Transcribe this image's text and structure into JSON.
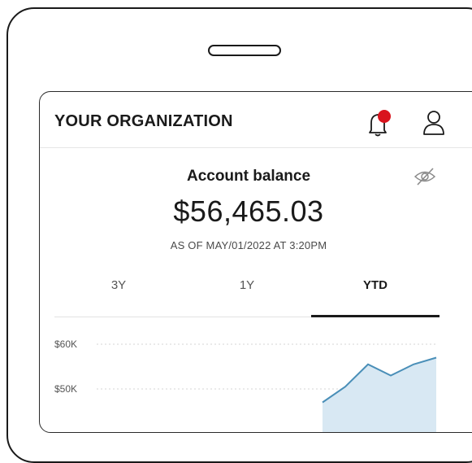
{
  "header": {
    "title": "YOUR ORGANIZATION",
    "notification_dot_color": "#d9141d"
  },
  "balance": {
    "label": "Account balance",
    "amount": "$56,465.03",
    "as_of": "AS OF MAY/01/2022 AT 3:20PM"
  },
  "tabs": [
    {
      "label": "3Y",
      "active": false
    },
    {
      "label": "1Y",
      "active": false
    },
    {
      "label": "YTD",
      "active": true
    }
  ],
  "colors": {
    "line": "#4a8fb8",
    "area": "#d8e8f3",
    "text": "#1a1a1a"
  },
  "chart_data": {
    "type": "area",
    "y_ticks": [
      "$60K",
      "$50K"
    ],
    "series": [
      {
        "values": [
          47000,
          50500,
          55500,
          53000,
          55500,
          57000
        ]
      }
    ],
    "ylim": [
      40000,
      62000
    ],
    "grid": true
  }
}
